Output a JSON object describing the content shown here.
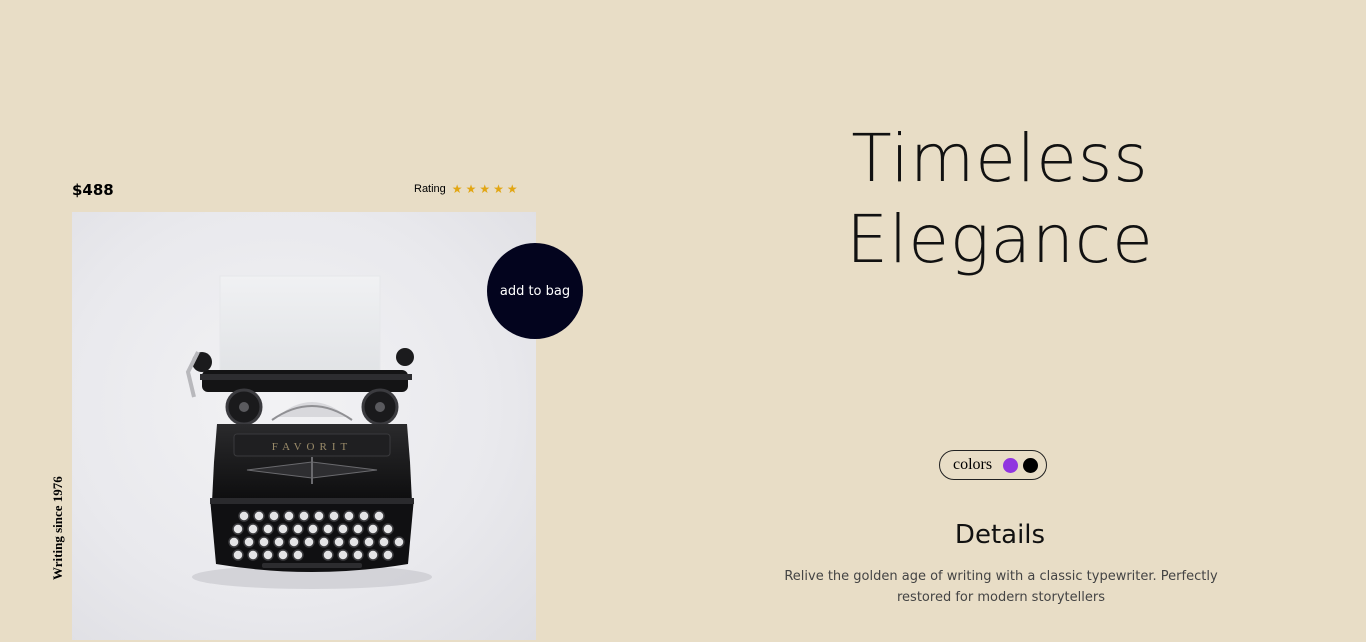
{
  "product": {
    "price": "$488",
    "rating_label": "Rating",
    "rating": 5,
    "rating_max": 5,
    "tagline": "Writing since 1976",
    "add_to_bag_label": "add to bag",
    "typewriter_brand": "FAVORIT"
  },
  "hero": {
    "title_line1": "Timeless",
    "title_line2": "Elegance"
  },
  "colors": {
    "label": "colors",
    "options": [
      {
        "name": "purple",
        "hex": "#9135e0"
      },
      {
        "name": "black",
        "hex": "#000000"
      }
    ]
  },
  "details": {
    "title": "Details",
    "text": "Relive the golden age of writing with a classic typewriter. Perfectly restored for modern storytellers"
  },
  "theme": {
    "background": "#e8ddc6",
    "button": "#03041e",
    "star": "#e2a613"
  }
}
